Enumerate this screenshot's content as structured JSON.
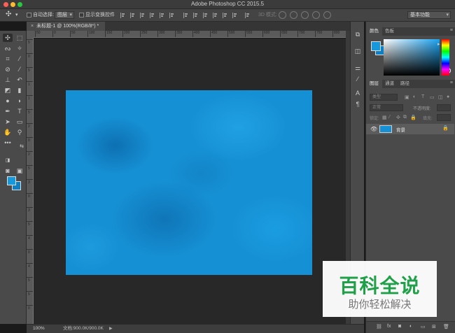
{
  "window": {
    "title": "Adobe Photoshop CC 2015.5"
  },
  "options_bar": {
    "auto_select_label": "自动选择:",
    "auto_select_value": "图层",
    "show_transform_label": "显示变换控件",
    "mode_3d_label": "3D 模式:",
    "workspace_value": "基本功能"
  },
  "document": {
    "tab_title": "未标题-1 @ 100%(RGB/8*) *",
    "tab_close_glyph": "×",
    "zoom": "100%",
    "doc_info": "文档:900.0K/900.0K",
    "status_arrow": "▶"
  },
  "ruler": {
    "h_ticks": [
      "50",
      "0",
      "50",
      "100",
      "150",
      "200",
      "250",
      "300",
      "350",
      "400",
      "450",
      "500",
      "550",
      "600",
      "650",
      "700",
      "750",
      "800",
      "850"
    ],
    "v_ticks": [
      "5",
      "0",
      "5",
      "1",
      "1",
      "5",
      "2",
      "0",
      "2",
      "5",
      "3",
      "0",
      "3",
      "5",
      "4",
      "0",
      "4",
      "5",
      "5",
      "0"
    ]
  },
  "panels": {
    "color_tabs": [
      "颜色",
      "色板"
    ],
    "layers_tabs": [
      "图层",
      "通道",
      "路径"
    ],
    "filter_kind": "类型",
    "blend_mode": "正常",
    "opacity_label": "不透明度:",
    "lock_label": "锁定:",
    "fill_label": "填充:",
    "menu_glyph": "≡"
  },
  "layers": [
    {
      "name": "背景",
      "visible": true,
      "locked": true
    }
  ],
  "layer_footer_icons": [
    "link-icon",
    "fx-icon",
    "mask-icon",
    "adjustment-icon",
    "group-icon",
    "new-layer-icon",
    "trash-icon"
  ],
  "colors": {
    "foreground": "#1598dc",
    "background": "#0e7fc5",
    "canvas": "#1690d4"
  },
  "watermark": {
    "main": "百科全说",
    "sub": "助你轻松解决"
  }
}
